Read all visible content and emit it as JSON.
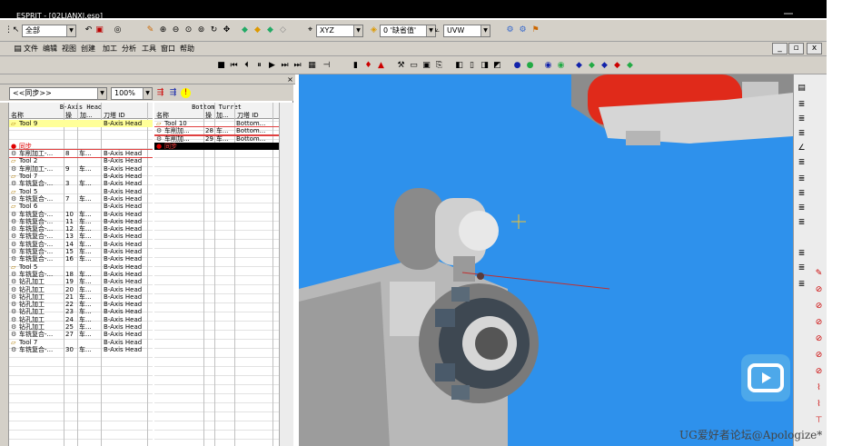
{
  "window": {
    "title": "ESPRIT - [02LIANXI.esp]"
  },
  "toolbar": {
    "filter_combo": "全部",
    "plane_combo": "XYZ",
    "workplane_combo": "0 '缺省值'",
    "uvw_combo": "UVW",
    "icons": [
      "pointer-icon",
      "undo-icon",
      "zoom-icon",
      "rotate-icon",
      "pan-icon",
      "cube-icon",
      "layer-icon",
      "plane-icon",
      "uvw-icon",
      "simulate-icon"
    ]
  },
  "menu": [
    "文件",
    "编辑",
    "视图",
    "创建",
    "加工",
    "分析",
    "工具",
    "窗口",
    "帮助"
  ],
  "window_buttons": [
    "_",
    "▫",
    "x"
  ],
  "sim_controls": [
    "■",
    "⏮",
    "⏴",
    "⏸",
    "▶",
    "⏭",
    "⏭"
  ],
  "ops_panel": {
    "sync_combo": "<<同步>>",
    "zoom_combo": "100%",
    "b_axis": {
      "title": "B-Axis Head",
      "columns": [
        "名称",
        "操",
        "加...",
        "刀塔 ID"
      ],
      "rows": [
        {
          "name": "Tool 9",
          "num": "",
          "op": "",
          "turret": "B-Axis Head",
          "type": "tool",
          "state": "selected"
        },
        {
          "name": "",
          "num": "",
          "op": "",
          "turret": "",
          "type": "blank"
        },
        {
          "name": "",
          "num": "",
          "op": "",
          "turret": "",
          "type": "blank"
        },
        {
          "name": "同步",
          "num": "",
          "op": "",
          "turret": "",
          "type": "sync"
        },
        {
          "name": "车削加工-...",
          "num": "8",
          "op": "车...",
          "turret": "B-Axis Head",
          "type": "op",
          "state": "boxed"
        },
        {
          "name": "Tool 2",
          "num": "",
          "op": "",
          "turret": "B-Axis Head",
          "type": "tool"
        },
        {
          "name": "车削加工-...",
          "num": "9",
          "op": "车...",
          "turret": "B-Axis Head",
          "type": "op"
        },
        {
          "name": "Tool 7",
          "num": "",
          "op": "",
          "turret": "B-Axis Head",
          "type": "tool"
        },
        {
          "name": "车铣复合-...",
          "num": "3",
          "op": "车...",
          "turret": "B-Axis Head",
          "type": "op"
        },
        {
          "name": "Tool 5",
          "num": "",
          "op": "",
          "turret": "B-Axis Head",
          "type": "tool"
        },
        {
          "name": "车铣复合-...",
          "num": "7",
          "op": "车...",
          "turret": "B-Axis Head",
          "type": "op"
        },
        {
          "name": "Tool 6",
          "num": "",
          "op": "",
          "turret": "B-Axis Head",
          "type": "tool"
        },
        {
          "name": "车铣复合-...",
          "num": "10",
          "op": "车...",
          "turret": "B-Axis Head",
          "type": "op"
        },
        {
          "name": "车铣复合-...",
          "num": "11",
          "op": "车...",
          "turret": "B-Axis Head",
          "type": "op"
        },
        {
          "name": "车铣复合-...",
          "num": "12",
          "op": "车...",
          "turret": "B-Axis Head",
          "type": "op"
        },
        {
          "name": "车铣复合-...",
          "num": "13",
          "op": "车...",
          "turret": "B-Axis Head",
          "type": "op"
        },
        {
          "name": "车铣复合-...",
          "num": "14",
          "op": "车...",
          "turret": "B-Axis Head",
          "type": "op"
        },
        {
          "name": "车铣复合-...",
          "num": "15",
          "op": "车...",
          "turret": "B-Axis Head",
          "type": "op"
        },
        {
          "name": "车铣复合-...",
          "num": "16",
          "op": "车...",
          "turret": "B-Axis Head",
          "type": "op"
        },
        {
          "name": "Tool 5",
          "num": "",
          "op": "",
          "turret": "B-Axis Head",
          "type": "tool"
        },
        {
          "name": "车铣复合-...",
          "num": "18",
          "op": "车...",
          "turret": "B-Axis Head",
          "type": "op"
        },
        {
          "name": "钻孔加工",
          "num": "19",
          "op": "车...",
          "turret": "B-Axis Head",
          "type": "op"
        },
        {
          "name": "钻孔加工",
          "num": "20",
          "op": "车...",
          "turret": "B-Axis Head",
          "type": "op"
        },
        {
          "name": "钻孔加工",
          "num": "21",
          "op": "车...",
          "turret": "B-Axis Head",
          "type": "op"
        },
        {
          "name": "钻孔加工",
          "num": "22",
          "op": "车...",
          "turret": "B-Axis Head",
          "type": "op"
        },
        {
          "name": "钻孔加工",
          "num": "23",
          "op": "车...",
          "turret": "B-Axis Head",
          "type": "op"
        },
        {
          "name": "钻孔加工",
          "num": "24",
          "op": "车...",
          "turret": "B-Axis Head",
          "type": "op"
        },
        {
          "name": "钻孔加工",
          "num": "25",
          "op": "车...",
          "turret": "B-Axis Head",
          "type": "op"
        },
        {
          "name": "车铣复合-...",
          "num": "27",
          "op": "车...",
          "turret": "B-Axis Head",
          "type": "op"
        },
        {
          "name": "Tool 7",
          "num": "",
          "op": "",
          "turret": "B-Axis Head",
          "type": "tool"
        },
        {
          "name": "车铣复合-...",
          "num": "30",
          "op": "车...",
          "turret": "B-Axis Head",
          "type": "op"
        }
      ]
    },
    "bottom_turret": {
      "title": "Bottom Turret",
      "columns": [
        "名称",
        "操",
        "加...",
        "刀塔 ID"
      ],
      "rows": [
        {
          "name": "Tool 10",
          "num": "",
          "op": "",
          "turret": "Bottom...",
          "type": "tool"
        },
        {
          "name": "车削加...",
          "num": "28",
          "op": "车...",
          "turret": "Bottom...",
          "type": "op",
          "state": "boxed"
        },
        {
          "name": "车削加...",
          "num": "29",
          "op": "车...",
          "turret": "Bottom...",
          "type": "op",
          "state": "boxed"
        },
        {
          "name": "同步",
          "num": "",
          "op": "",
          "turret": "",
          "type": "sync",
          "state": "highlight"
        }
      ]
    }
  },
  "colors": {
    "viewport": "#2e91ec",
    "panel": "#d4d0c8",
    "sync": "#e00000",
    "selected": "#ffff99",
    "chuck": "#e02a1a"
  },
  "watermark": "UG爱好者论坛@Apologize*"
}
